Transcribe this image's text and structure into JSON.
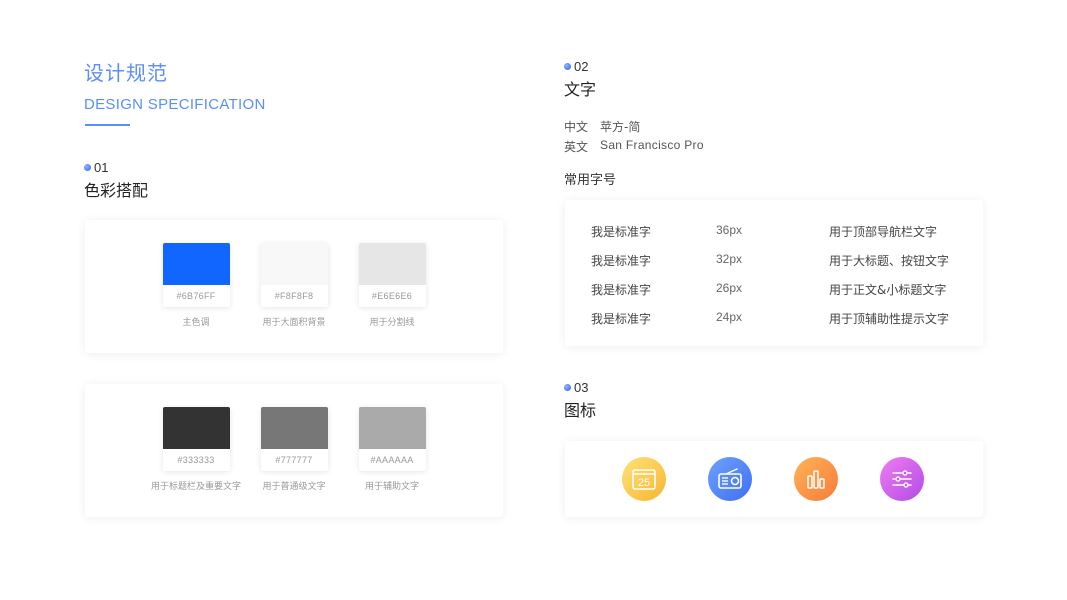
{
  "header": {
    "title_cn": "设计规范",
    "title_en": "DESIGN SPECIFICATION"
  },
  "section1": {
    "num": "01",
    "title": "色彩搭配",
    "card1": [
      {
        "hex": "#6B76FF",
        "label": "主色调",
        "color": "#1166ff"
      },
      {
        "hex": "#F8F8F8",
        "label": "用于大面积背景",
        "color": "#f8f8f8"
      },
      {
        "hex": "#E6E6E6",
        "label": "用于分割线",
        "color": "#e6e6e6"
      }
    ],
    "card2": [
      {
        "hex": "#333333",
        "label": "用于标题栏及重要文字",
        "color": "#333333"
      },
      {
        "hex": "#777777",
        "label": "用于普通级文字",
        "color": "#777777"
      },
      {
        "hex": "#AAAAAA",
        "label": "用于辅助文字",
        "color": "#aaaaaa"
      }
    ]
  },
  "section2": {
    "num": "02",
    "title": "文字",
    "fonts": [
      {
        "lang": "中文",
        "font": "苹方-简"
      },
      {
        "lang": "英文",
        "font": "San Francisco Pro"
      }
    ],
    "common_label": "常用字号",
    "sizes": [
      {
        "sample": "我是标准字",
        "size": "36px",
        "usage": "用于顶部导航栏文字"
      },
      {
        "sample": "我是标准字",
        "size": "32px",
        "usage": "用于大标题、按钮文字"
      },
      {
        "sample": "我是标准字",
        "size": "26px",
        "usage": "用于正文&小标题文字"
      },
      {
        "sample": "我是标准字",
        "size": "24px",
        "usage": "用于顶辅助性提示文字"
      }
    ]
  },
  "section3": {
    "num": "03",
    "title": "图标",
    "icons": [
      "calendar-icon",
      "radio-icon",
      "bar-chart-icon",
      "settings-sliders-icon"
    ],
    "calendar_day": "25"
  },
  "colors": {
    "accent": "#5b8ef7"
  }
}
